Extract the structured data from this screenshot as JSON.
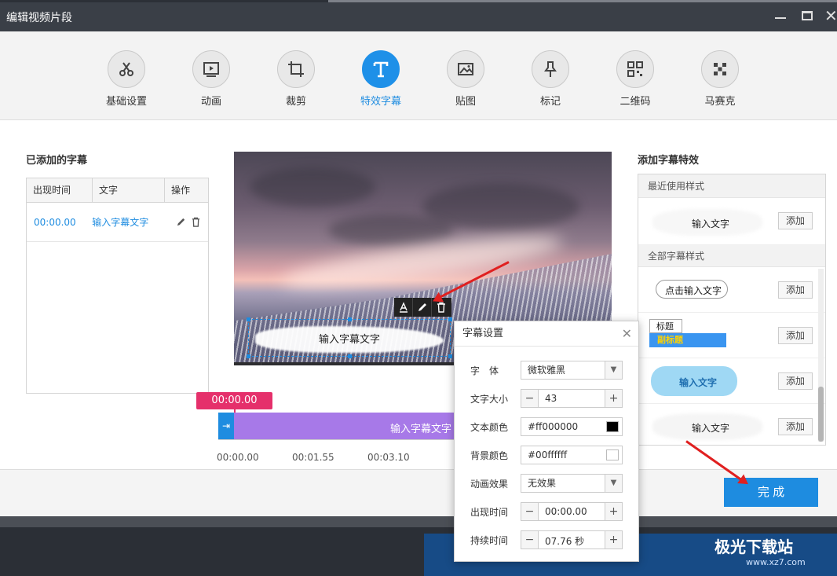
{
  "window": {
    "title": "编辑视频片段",
    "close_glyph": "✕"
  },
  "toolbar": {
    "items": [
      {
        "label": "基础设置",
        "icon": "scissors-icon"
      },
      {
        "label": "动画",
        "icon": "play-frame-icon"
      },
      {
        "label": "裁剪",
        "icon": "crop-icon"
      },
      {
        "label": "特效字幕",
        "icon": "text-t-icon",
        "active": true
      },
      {
        "label": "贴图",
        "icon": "image-icon"
      },
      {
        "label": "标记",
        "icon": "pin-icon"
      },
      {
        "label": "二维码",
        "icon": "qrcode-icon"
      },
      {
        "label": "马赛克",
        "icon": "mosaic-icon"
      }
    ]
  },
  "subtitles": {
    "title": "已添加的字幕",
    "columns": [
      "出现时间",
      "文字",
      "操作"
    ],
    "rows": [
      {
        "time": "00:00.00",
        "text": "输入字幕文字"
      }
    ]
  },
  "preview": {
    "subtitle_text": "输入字幕文字"
  },
  "timeline": {
    "cursor_time": "00:00.00",
    "clip_text": "输入字幕文字",
    "ticks": [
      "00:00.00",
      "00:01.55",
      "00:03.10"
    ]
  },
  "effects": {
    "title": "添加字幕特效",
    "recent_header": "最近使用样式",
    "all_header": "全部字幕样式",
    "add_label": "添加",
    "recent": [
      {
        "text": "输入文字"
      }
    ],
    "all": [
      {
        "text": "点击输入文字"
      },
      {
        "text": "标题",
        "text2": "副标题"
      },
      {
        "text": "输入文字"
      },
      {
        "text": "输入文字"
      }
    ]
  },
  "dialog": {
    "title": "字幕设置",
    "font_label": "字　体",
    "font_value": "微软雅黑",
    "size_label": "文字大小",
    "size_value": "43",
    "text_color_label": "文本颜色",
    "text_color_value": "#ff000000",
    "bg_color_label": "背景颜色",
    "bg_color_value": "#00ffffff",
    "anim_label": "动画效果",
    "anim_value": "无效果",
    "appear_label": "出现时间",
    "appear_value": "00:00.00",
    "duration_label": "持续时间",
    "duration_value": "07.76 秒"
  },
  "footer": {
    "done_label": "完 成"
  },
  "watermark": {
    "text": "极光下载站",
    "url": "www.xz7.com"
  },
  "colors": {
    "accent": "#1e8ce0",
    "timeline_clip": "#a779e8",
    "cursor": "#e5306b",
    "arrow": "#e02020"
  }
}
